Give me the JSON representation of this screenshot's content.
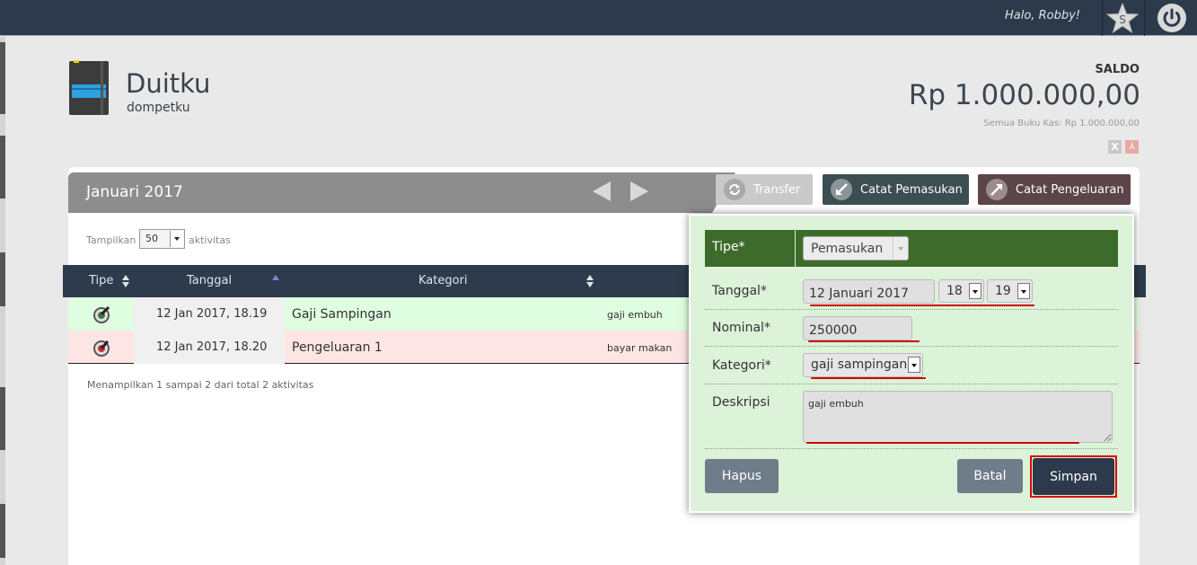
{
  "topbar": {
    "greeting": "Halo, Robby!",
    "star_letter": "S"
  },
  "header": {
    "title": "Duitku",
    "subtitle": "dompetku",
    "saldo_label": "SALDO",
    "saldo_value": "Rp 1.000.000,00",
    "saldo_all": "Semua Buku Kas: Rp 1.000.000,00",
    "export_excel": "X",
    "export_pdf": "⅄"
  },
  "toolbar": {
    "month": "Januari 2017",
    "transfer_label": "Transfer",
    "income_label": "Catat Pemasukan",
    "expense_label": "Catat Pengeluaran"
  },
  "list": {
    "show_prefix": "Tampilkan",
    "show_value": "50",
    "show_suffix": "aktivitas",
    "columns": {
      "tipe": "Tipe",
      "tanggal": "Tanggal",
      "kategori": "Kategori"
    },
    "rows": [
      {
        "type": "income",
        "date": "12 Jan 2017, 18.19",
        "category": "Gaji Sampingan",
        "description": "gaji embuh"
      },
      {
        "type": "expense",
        "date": "12 Jan 2017, 18.20",
        "category": "Pengeluaran 1",
        "description": "bayar makan"
      }
    ],
    "summary": "Menampilkan 1 sampai 2 dari total 2 aktivitas"
  },
  "form": {
    "tipe_label": "Tipe*",
    "tipe_value": "Pemasukan",
    "tanggal_label": "Tanggal*",
    "tanggal_value": "12 Januari 2017",
    "hour_value": "18",
    "minute_value": "19",
    "nominal_label": "Nominal*",
    "nominal_value": "250000",
    "kategori_label": "Kategori*",
    "kategori_value": "gaji sampingan",
    "deskripsi_label": "Deskripsi",
    "deskripsi_value": "gaji embuh",
    "hapus_label": "Hapus",
    "batal_label": "Batal",
    "simpan_label": "Simpan"
  },
  "colors": {
    "topbar": "#2c3a4b",
    "income_row": "#dffde0",
    "expense_row": "#fde5e5",
    "form_bg": "#dcf2d9",
    "form_header": "#3d6b2c",
    "annotation_red": "#cc0000"
  },
  "icons": [
    "star-icon",
    "power-icon",
    "notebook-icon",
    "transfer-icon",
    "income-icon",
    "expense-icon",
    "excel-icon",
    "pdf-icon"
  ]
}
